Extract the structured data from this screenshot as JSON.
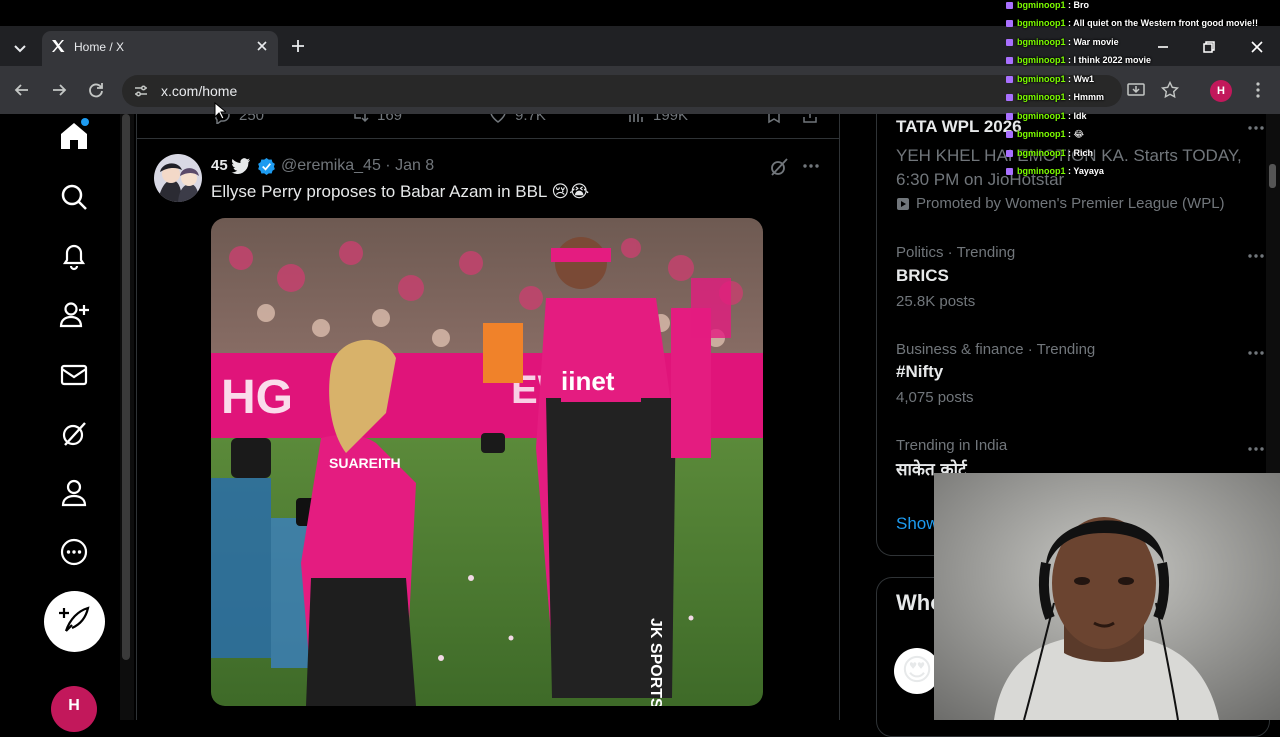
{
  "browser": {
    "tab_title": "Home / X",
    "url": "x.com/home",
    "profile_initial": "H"
  },
  "nav": {
    "items": [
      "home-icon",
      "search-icon",
      "notifications-icon",
      "follow-icon",
      "messages-icon",
      "grok-icon",
      "profile-icon",
      "more-icon"
    ],
    "account_initial": "H"
  },
  "prev_tweet": {
    "replies": "250",
    "reposts": "169",
    "likes": "9.7K",
    "views": "199K"
  },
  "tweet": {
    "name": "45",
    "handle": "@eremika_45 · Jan 8",
    "text": "Ellyse Perry proposes to Babar Azam in BBL 😢😭",
    "media_shirt_text": "iinet",
    "media_back_name": "SUAREITH",
    "media_sponsor": "JK SPORTS BL"
  },
  "sidebar": {
    "promo": {
      "title": "TATA WPL 2026",
      "desc": "YEH KHEL HAI EMOTION KA. Starts TODAY, 6:30 PM on JioHotstar",
      "by": "Promoted by Women's Premier League (WPL)"
    },
    "trends": [
      {
        "context": "Politics · Trending",
        "title": "BRICS",
        "posts": "25.8K posts"
      },
      {
        "context": "Business & finance · Trending",
        "title": "#Nifty",
        "posts": "4,075 posts"
      },
      {
        "context": "Trending in India",
        "title": "साकेत कोर्ट",
        "posts": ""
      }
    ],
    "show_more": "Show more",
    "who_to_follow": "Who to follow"
  },
  "chat": [
    {
      "user": "bgminoop1",
      "msg": "Bro"
    },
    {
      "user": "bgminoop1",
      "msg": "All quiet on the Western front good movie!!"
    },
    {
      "user": "bgminoop1",
      "msg": "War movie"
    },
    {
      "user": "bgminoop1",
      "msg": "I think 2022 movie"
    },
    {
      "user": "bgminoop1",
      "msg": "Ww1"
    },
    {
      "user": "bgminoop1",
      "msg": "Hmmm"
    },
    {
      "user": "bgminoop1",
      "msg": "Idk"
    },
    {
      "user": "bgminoop1",
      "msg": "😂"
    },
    {
      "user": "bgminoop1",
      "msg": "Rich"
    },
    {
      "user": "bgminoop1",
      "msg": "Yayaya"
    }
  ],
  "colors": {
    "accent": "#1d9bf0",
    "background": "#000000",
    "pink": "#e0147a"
  }
}
